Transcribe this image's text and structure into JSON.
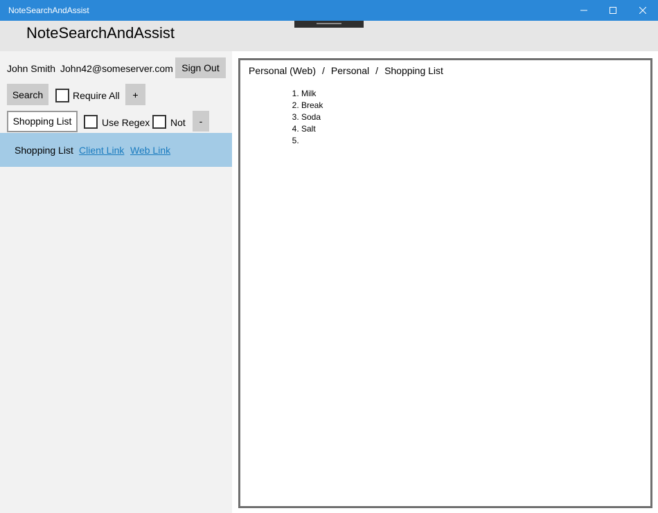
{
  "window": {
    "title": "NoteSearchAndAssist"
  },
  "app": {
    "heading": "NoteSearchAndAssist"
  },
  "user": {
    "name": "John Smith",
    "email": "John42@someserver.com",
    "sign_out_label": "Sign Out"
  },
  "search": {
    "button_label": "Search",
    "require_all_label": "Require All",
    "require_all_checked": false,
    "add_label": "+"
  },
  "term": {
    "value": "Shopping List",
    "use_regex_label": "Use Regex",
    "use_regex_checked": false,
    "not_label": "Not",
    "not_checked": false,
    "remove_label": "-"
  },
  "results": [
    {
      "title": "Shopping List",
      "client_link": "Client Link",
      "web_link": "Web Link"
    }
  ],
  "note": {
    "breadcrumb": [
      "Personal (Web)",
      "Personal",
      "Shopping List"
    ],
    "separator": "/",
    "items": [
      "Milk",
      "Break",
      "Soda",
      "Salt",
      ""
    ]
  },
  "colors": {
    "titlebar": "#2b88d8",
    "header": "#e6e6e6",
    "left_panel": "#f2f2f2",
    "selected_result": "#a3cbe6",
    "link": "#1a7bbf",
    "button": "#cccccc"
  }
}
